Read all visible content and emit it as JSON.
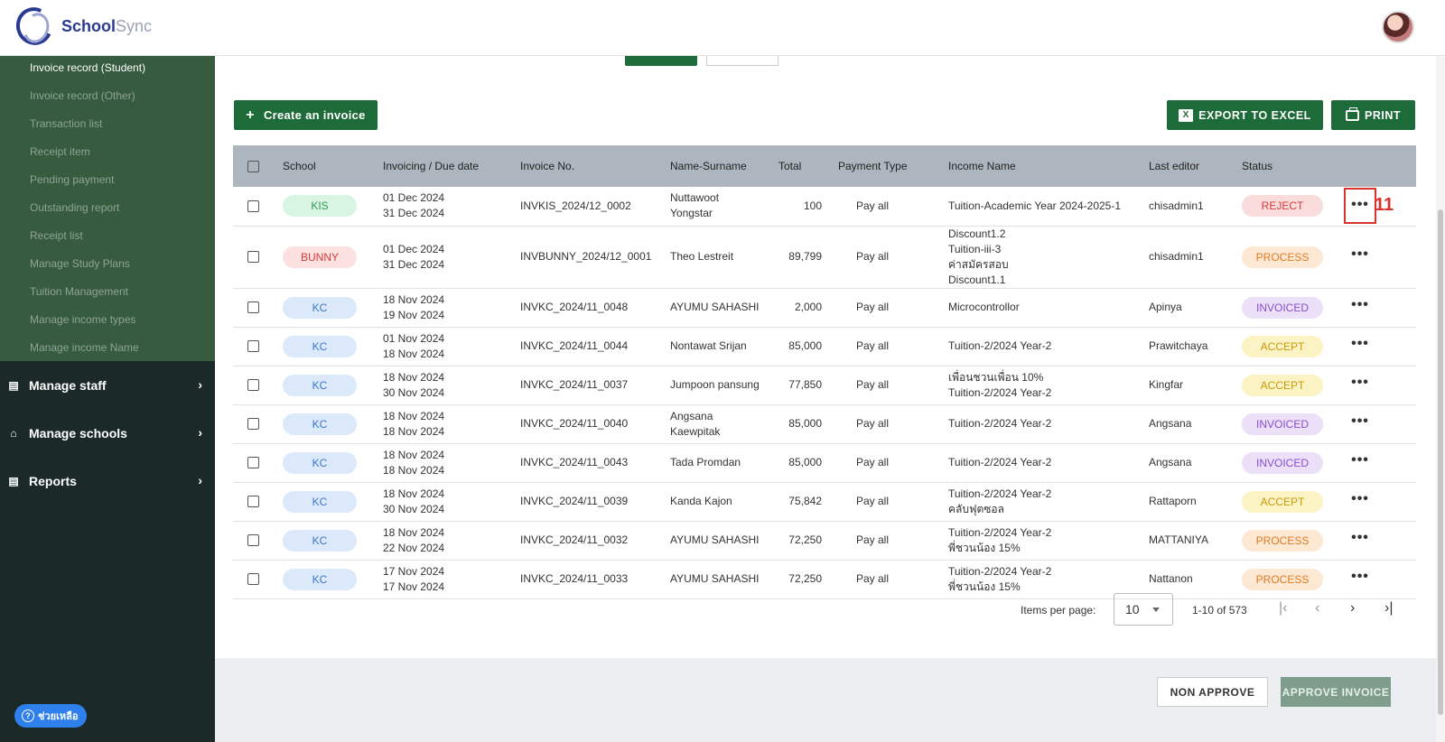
{
  "header": {
    "brand_primary": "School",
    "brand_secondary": "Sync"
  },
  "sidebar": {
    "sub_items": [
      {
        "label": "Invoice record (Student)",
        "active": true
      },
      {
        "label": "Invoice record (Other)"
      },
      {
        "label": "Transaction list"
      },
      {
        "label": "Receipt item"
      },
      {
        "label": "Pending payment"
      },
      {
        "label": "Outstanding report"
      },
      {
        "label": "Receipt list"
      },
      {
        "label": "Manage Study Plans"
      },
      {
        "label": "Tuition Management"
      },
      {
        "label": "Manage income types"
      },
      {
        "label": "Manage income Name"
      }
    ],
    "main_items": [
      {
        "label": "Manage staff",
        "icon": "staff-icon"
      },
      {
        "label": "Manage schools",
        "icon": "school-icon"
      },
      {
        "label": "Reports",
        "icon": "report-icon"
      }
    ],
    "help_label": "ช่วยเหลือ"
  },
  "toolbar": {
    "create_label": "Create an invoice",
    "export_label": "EXPORT TO EXCEL",
    "print_label": "PRINT"
  },
  "table": {
    "headers": {
      "school": "School",
      "dates": "Invoicing / Due date",
      "invoice_no": "Invoice No.",
      "name": "Name-Surname",
      "total": "Total",
      "payment_type": "Payment Type",
      "income_name": "Income Name",
      "last_editor": "Last editor",
      "status": "Status"
    },
    "rows": [
      {
        "school": "KIS",
        "school_style": "kis",
        "inv_date": "01 Dec 2024",
        "due_date": "31 Dec 2024",
        "invoice_no": "INVKIS_2024/12_0002",
        "name": "Nuttawoot Yongstar",
        "total": "100",
        "payment_type": "Pay all",
        "income": [
          "Tuition-Academic Year 2024-2025-1"
        ],
        "editor": "chisadmin1",
        "status": "REJECT",
        "status_style": "reject"
      },
      {
        "school": "BUNNY",
        "school_style": "bunny",
        "inv_date": "01 Dec 2024",
        "due_date": "31 Dec 2024",
        "invoice_no": "INVBUNNY_2024/12_0001",
        "name": "Theo Lestreit",
        "total": "89,799",
        "payment_type": "Pay all",
        "income": [
          "Discount1.2",
          "Tuition-iii-3",
          "ค่าสมัครสอบ",
          "Discount1.1"
        ],
        "editor": "chisadmin1",
        "status": "PROCESS",
        "status_style": "process"
      },
      {
        "school": "KC",
        "school_style": "kc",
        "inv_date": "18 Nov 2024",
        "due_date": "19 Nov 2024",
        "invoice_no": "INVKC_2024/11_0048",
        "name": "AYUMU SAHASHI",
        "total": "2,000",
        "payment_type": "Pay all",
        "income": [
          "Microcontrollor"
        ],
        "editor": "Apinya",
        "status": "INVOICED",
        "status_style": "invoiced"
      },
      {
        "school": "KC",
        "school_style": "kc",
        "inv_date": "01 Nov 2024",
        "due_date": "18 Nov 2024",
        "invoice_no": "INVKC_2024/11_0044",
        "name": "Nontawat Srijan",
        "total": "85,000",
        "payment_type": "Pay all",
        "income": [
          "Tuition-2/2024 Year-2"
        ],
        "editor": "Prawitchaya",
        "status": "ACCEPT",
        "status_style": "accept"
      },
      {
        "school": "KC",
        "school_style": "kc",
        "inv_date": "18 Nov 2024",
        "due_date": "30 Nov 2024",
        "invoice_no": "INVKC_2024/11_0037",
        "name": "Jumpoon pansung",
        "total": "77,850",
        "payment_type": "Pay all",
        "income": [
          "เพื่อนชวนเพื่อน 10%",
          "Tuition-2/2024 Year-2"
        ],
        "editor": "Kingfar",
        "status": "ACCEPT",
        "status_style": "accept"
      },
      {
        "school": "KC",
        "school_style": "kc",
        "inv_date": "18 Nov 2024",
        "due_date": "18 Nov 2024",
        "invoice_no": "INVKC_2024/11_0040",
        "name": "Angsana Kaewpitak",
        "total": "85,000",
        "payment_type": "Pay all",
        "income": [
          "Tuition-2/2024 Year-2"
        ],
        "editor": "Angsana",
        "status": "INVOICED",
        "status_style": "invoiced"
      },
      {
        "school": "KC",
        "school_style": "kc",
        "inv_date": "18 Nov 2024",
        "due_date": "18 Nov 2024",
        "invoice_no": "INVKC_2024/11_0043",
        "name": "Tada Promdan",
        "total": "85,000",
        "payment_type": "Pay all",
        "income": [
          "Tuition-2/2024 Year-2"
        ],
        "editor": "Angsana",
        "status": "INVOICED",
        "status_style": "invoiced"
      },
      {
        "school": "KC",
        "school_style": "kc",
        "inv_date": "18 Nov 2024",
        "due_date": "30 Nov 2024",
        "invoice_no": "INVKC_2024/11_0039",
        "name": "Kanda Kajon",
        "total": "75,842",
        "payment_type": "Pay all",
        "income": [
          "Tuition-2/2024 Year-2",
          "คลับฟุตซอล"
        ],
        "editor": "Rattaporn",
        "status": "ACCEPT",
        "status_style": "accept"
      },
      {
        "school": "KC",
        "school_style": "kc",
        "inv_date": "18 Nov 2024",
        "due_date": "22 Nov 2024",
        "invoice_no": "INVKC_2024/11_0032",
        "name": "AYUMU SAHASHI",
        "total": "72,250",
        "payment_type": "Pay all",
        "income": [
          "Tuition-2/2024 Year-2",
          "พี่ชวนน้อง 15%"
        ],
        "editor": "MATTANIYA",
        "status": "PROCESS",
        "status_style": "process"
      },
      {
        "school": "KC",
        "school_style": "kc",
        "inv_date": "17 Nov 2024",
        "due_date": "17 Nov 2024",
        "invoice_no": "INVKC_2024/11_0033",
        "name": "AYUMU SAHASHI",
        "total": "72,250",
        "payment_type": "Pay all",
        "income": [
          "Tuition-2/2024 Year-2",
          "พี่ชวนน้อง 15%"
        ],
        "editor": "Nattanon",
        "status": "PROCESS",
        "status_style": "process"
      }
    ]
  },
  "annotation": "11",
  "pagination": {
    "items_per_page_label": "Items per page:",
    "items_per_page": "10",
    "range": "1-10 of 573"
  },
  "footer": {
    "non_approve_label": "NON APPROVE",
    "approve_label": "APPROVE INVOICE"
  }
}
